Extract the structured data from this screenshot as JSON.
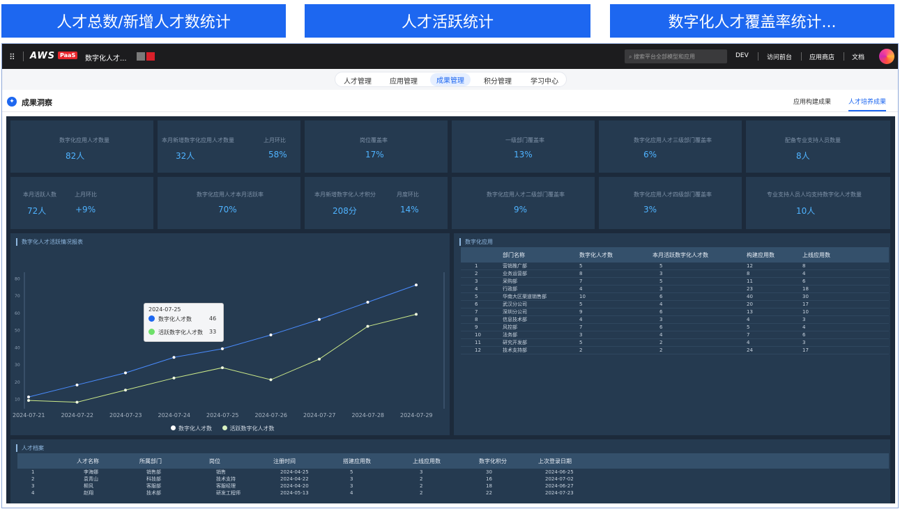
{
  "top_tabs": [
    "人才总数/新增人才数统计",
    "人才活跃统计",
    "数字化人才覆盖率统计..."
  ],
  "appbar": {
    "logo": "AWS",
    "logo_badge": "PaaS",
    "app_title": "数字化人才...",
    "search_placeholder": "搜索平台全部模型和应用",
    "nav": [
      "DEV",
      "访问前台",
      "应用商店",
      "文档"
    ]
  },
  "subnav": {
    "items": [
      "人才管理",
      "应用管理",
      "成果管理",
      "积分管理",
      "学习中心"
    ],
    "active": "成果管理"
  },
  "section": {
    "title": "成果洞察",
    "right_tabs": [
      "应用构建成果",
      "人才培养成果"
    ],
    "active_right_tab": "人才培养成果"
  },
  "cards_row1": [
    {
      "label": "数字化应用人才数量",
      "value": "82人"
    },
    {
      "label": "本月新增数字化应用人才数量",
      "value": "32人",
      "label2": "上月环比",
      "value2": "58%"
    },
    {
      "label": "岗位覆盖率",
      "value": "17%"
    },
    {
      "label": "一级部门覆盖率",
      "value": "13%"
    },
    {
      "label": "数字化应用人才三级部门覆盖率",
      "value": "6%"
    },
    {
      "label": "配备专业支持人员数量",
      "value": "8人"
    }
  ],
  "cards_row2": [
    {
      "label": "本月活跃人数",
      "value": "72人",
      "label2": "上月环比",
      "value2": "+9%"
    },
    {
      "label": "数字化应用人才本月活跃率",
      "value": "70%"
    },
    {
      "label": "本月新增数字化人才积分",
      "value": "208分",
      "label2": "月度环比",
      "value2": "14%"
    },
    {
      "label": "数字化应用人才二级部门覆盖率",
      "value": "9%"
    },
    {
      "label": "数字化应用人才四级部门覆盖率",
      "value": "3%"
    },
    {
      "label": "专业支持人员人均支持数字化人才数量",
      "value": "10人"
    }
  ],
  "chart_panel_title": "数字化人才活跃情况报表",
  "chart_data": {
    "type": "line",
    "x": [
      "2024-07-21",
      "2024-07-22",
      "2024-07-23",
      "2024-07-24",
      "2024-07-25",
      "2024-07-26",
      "2024-07-27",
      "2024-07-28",
      "2024-07-29"
    ],
    "y_ticks": [
      "80",
      "70",
      "60",
      "50",
      "40",
      "30",
      "20",
      "10"
    ],
    "ylim": [
      5,
      85
    ],
    "series": [
      {
        "name": "数字化人才数",
        "values": [
          11,
          18,
          25,
          34,
          39,
          47,
          56,
          66,
          76
        ],
        "color": "#4a8cff"
      },
      {
        "name": "活跃数字化人才数",
        "values": [
          9,
          8,
          15,
          22,
          28,
          21,
          33,
          52,
          59
        ],
        "color": "#cdeb8a"
      }
    ],
    "tooltip": {
      "date": "2024-07-25",
      "rows": [
        {
          "name": "数字化人才数",
          "value": "46",
          "color": "#1d67f0"
        },
        {
          "name": "活跃数字化人才数",
          "value": "33",
          "color": "#6ee06a"
        }
      ]
    }
  },
  "dept_panel": {
    "title": "数字化应用",
    "columns": [
      "",
      "部门名称",
      "数字化人才数",
      "本月活跃数字化人才数",
      "构建应用数",
      "上线应用数"
    ],
    "rows": [
      [
        "1",
        "营销推广部",
        "5",
        "5",
        "12",
        "8"
      ],
      [
        "2",
        "业务运营部",
        "8",
        "3",
        "8",
        "4"
      ],
      [
        "3",
        "采购部",
        "7",
        "5",
        "11",
        "6"
      ],
      [
        "4",
        "行政部",
        "4",
        "3",
        "23",
        "18"
      ],
      [
        "5",
        "华南大区渠道销售部",
        "10",
        "6",
        "40",
        "30"
      ],
      [
        "6",
        "武汉分公司",
        "5",
        "4",
        "20",
        "17"
      ],
      [
        "7",
        "深圳分公司",
        "9",
        "6",
        "13",
        "10"
      ],
      [
        "8",
        "信息技术部",
        "4",
        "3",
        "4",
        "3"
      ],
      [
        "9",
        "风控部",
        "7",
        "6",
        "5",
        "4"
      ],
      [
        "10",
        "法务部",
        "3",
        "4",
        "7",
        "6"
      ],
      [
        "11",
        "研究开发部",
        "5",
        "2",
        "4",
        "3"
      ],
      [
        "12",
        "技术支持部",
        "2",
        "2",
        "24",
        "17"
      ]
    ]
  },
  "talent_panel": {
    "title": "人才档案",
    "columns": [
      "",
      "人才名称",
      "所属部门",
      "岗位",
      "注册时间",
      "搭建应用数",
      "上线应用数",
      "数字化积分",
      "上次登录日期"
    ],
    "rows": [
      [
        "1",
        "李海娜",
        "销售部",
        "销售",
        "2024-04-25",
        "5",
        "3",
        "30",
        "2024-06-25"
      ],
      [
        "2",
        "袁青山",
        "科技部",
        "技术支持",
        "2024-04-22",
        "3",
        "2",
        "16",
        "2024-07-02"
      ],
      [
        "3",
        "柳风",
        "客服部",
        "客服经理",
        "2024-04-20",
        "3",
        "2",
        "18",
        "2024-06-27"
      ],
      [
        "4",
        "赵翔",
        "技术部",
        "研发工程师",
        "2024-05-13",
        "4",
        "2",
        "22",
        "2024-07-23"
      ]
    ]
  }
}
